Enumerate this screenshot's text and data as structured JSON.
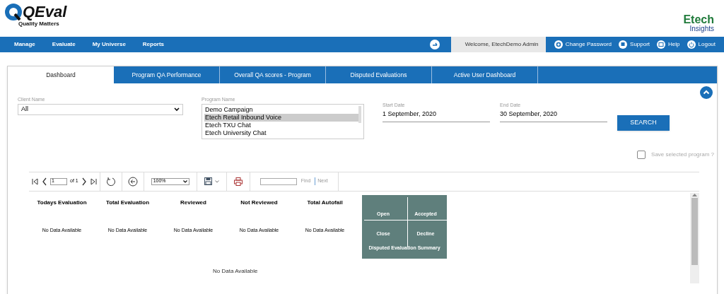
{
  "logo": {
    "brand": "QEval",
    "tagline": "Quality Matters"
  },
  "partner_logo": {
    "brand": "Etech",
    "sub": "Insights"
  },
  "nav": {
    "items": [
      "Manage",
      "Evaluate",
      "My Universe",
      "Reports"
    ],
    "welcome": "Welcome, EtechDemo Admin",
    "links": [
      {
        "kind": "gear",
        "label": "Change Password"
      },
      {
        "kind": "support",
        "label": "Support"
      },
      {
        "kind": "help",
        "label": "Help"
      },
      {
        "kind": "power",
        "label": "Logout"
      }
    ]
  },
  "tabs": [
    {
      "label": "Dashboard",
      "selected": true
    },
    {
      "label": "Program QA Performance",
      "selected": false
    },
    {
      "label": "Overall QA scores - Program",
      "selected": false
    },
    {
      "label": "Disputed Evaluations",
      "selected": false
    },
    {
      "label": "Active User Dashboard",
      "selected": false
    }
  ],
  "filters": {
    "client": {
      "label": "Client Name",
      "value": "All"
    },
    "program": {
      "label": "Program Name",
      "options": [
        {
          "label": "Demo Campaign",
          "selected": false
        },
        {
          "label": "Etech Retail Inbound Voice",
          "selected": true
        },
        {
          "label": "Etech TXU Chat",
          "selected": false
        },
        {
          "label": "Etech University Chat",
          "selected": false
        }
      ]
    },
    "start_date": {
      "label": "Start Date",
      "value": "1 September, 2020"
    },
    "end_date": {
      "label": "End Date",
      "value": "30 September, 2020"
    },
    "search_button": "SEARCH",
    "save_program": {
      "label": "Save selected program ?",
      "checked": false
    }
  },
  "report_toolbar": {
    "page": "1",
    "of": "of 1",
    "zoom": "100%",
    "find": "Find",
    "next": "Next"
  },
  "stats": [
    {
      "title": "Todays Evaluation",
      "value": "No Data Available"
    },
    {
      "title": "Total Evaluation",
      "value": "No Data Available"
    },
    {
      "title": "Reviewed",
      "value": "No Data Available"
    },
    {
      "title": "Not Reviewed",
      "value": "No Data Available"
    },
    {
      "title": "Total Autofail",
      "value": "No Data Available"
    }
  ],
  "disputed_summary": {
    "cells": [
      "Open",
      "Accepted",
      "Close",
      "Decline"
    ],
    "title": "Disputed Evaluation Summary"
  },
  "bottom_message": "No Data Available"
}
